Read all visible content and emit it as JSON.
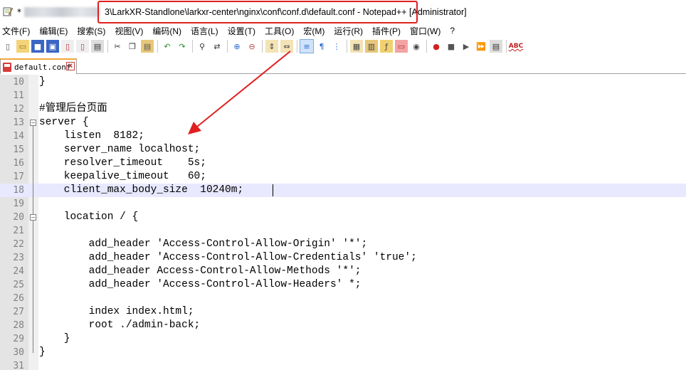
{
  "window": {
    "title_prefix": "*",
    "title_main": "3\\LarkXR-Standlone\\larkxr-center\\nginx\\conf\\conf.d\\default.conf - Notepad++ [Administrator]"
  },
  "menu": [
    "文件(F)",
    "编辑(E)",
    "搜索(S)",
    "视图(V)",
    "编码(N)",
    "语言(L)",
    "设置(T)",
    "工具(O)",
    "宏(M)",
    "运行(R)",
    "插件(P)",
    "窗口(W)",
    "?"
  ],
  "toolbar": {
    "icons": [
      "new-file-icon",
      "open-file-icon",
      "save-icon",
      "save-all-icon",
      "close-icon",
      "close-all-icon",
      "print-icon",
      "sep",
      "cut-icon",
      "copy-icon",
      "paste-icon",
      "sep",
      "undo-icon",
      "redo-icon",
      "sep",
      "find-icon",
      "replace-icon",
      "sep",
      "zoom-in-icon",
      "zoom-out-icon",
      "sep",
      "sync-vertical-icon",
      "sync-horizontal-icon",
      "sep",
      "word-wrap-icon",
      "show-all-chars-icon",
      "indent-guide-icon",
      "sep",
      "udl-icon",
      "doc-map-icon",
      "function-list-icon",
      "folder-workspace-icon",
      "monitoring-icon",
      "sep",
      "record-macro-icon",
      "stop-record-icon",
      "play-macro-icon",
      "run-macro-multiple-icon",
      "save-macro-icon",
      "sep",
      "spell-check-icon"
    ],
    "spell_check_label": "ABC"
  },
  "tab": {
    "label": "default.conf",
    "close_glyph": "x"
  },
  "editor": {
    "current_line": 18,
    "lines": [
      {
        "n": "10",
        "text": "}"
      },
      {
        "n": "11",
        "text": ""
      },
      {
        "n": "12",
        "text": "#管理后台页面"
      },
      {
        "n": "13",
        "text": "server {"
      },
      {
        "n": "14",
        "text": "    listen  8182;"
      },
      {
        "n": "15",
        "text": "    server_name localhost;"
      },
      {
        "n": "16",
        "text": "    resolver_timeout    5s;"
      },
      {
        "n": "17",
        "text": "    keepalive_timeout   60;"
      },
      {
        "n": "18",
        "text": "    client_max_body_size  10240m;"
      },
      {
        "n": "19",
        "text": ""
      },
      {
        "n": "20",
        "text": "    location / {"
      },
      {
        "n": "21",
        "text": ""
      },
      {
        "n": "22",
        "text": "        add_header 'Access-Control-Allow-Origin' '*';"
      },
      {
        "n": "23",
        "text": "        add_header 'Access-Control-Allow-Credentials' 'true';"
      },
      {
        "n": "24",
        "text": "        add_header Access-Control-Allow-Methods '*';"
      },
      {
        "n": "25",
        "text": "        add_header 'Access-Control-Allow-Headers' *;"
      },
      {
        "n": "26",
        "text": ""
      },
      {
        "n": "27",
        "text": "        index index.html;"
      },
      {
        "n": "28",
        "text": "        root ./admin-back;"
      },
      {
        "n": "29",
        "text": "    }"
      },
      {
        "n": "30",
        "text": "}"
      },
      {
        "n": "31",
        "text": ""
      }
    ]
  },
  "annotation": {
    "color": "#e02020"
  }
}
